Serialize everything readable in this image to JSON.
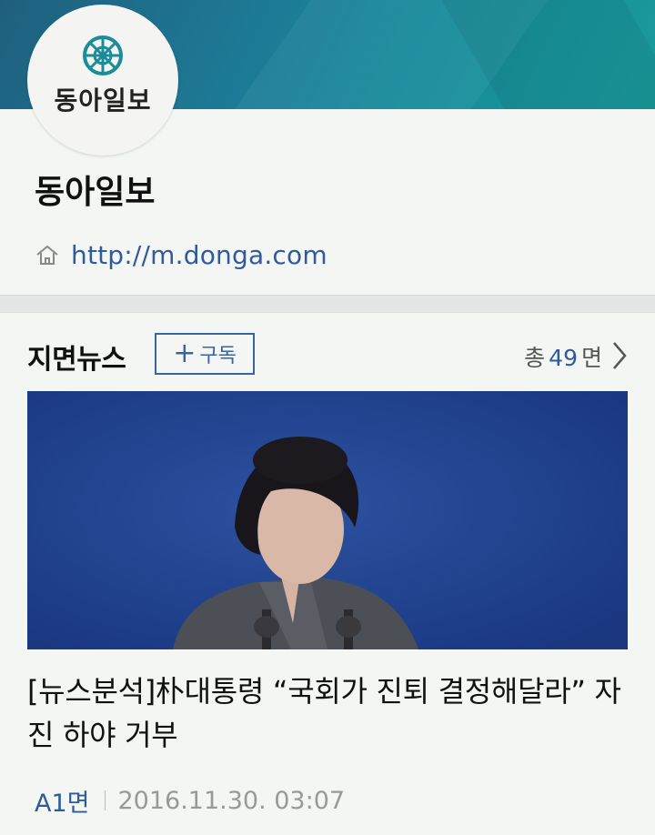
{
  "header": {
    "logo_text": "동아일보",
    "publisher_name": "동아일보",
    "url": "http://m.donga.com"
  },
  "section": {
    "title": "지면뉴스",
    "subscribe_label": "구독",
    "subscribe_icon": "plus-icon",
    "total_prefix": "총",
    "total_count": "49",
    "total_suffix": "면"
  },
  "article": {
    "headline": "[뉴스분석]朴대통령 “국회가 진퇴 결정해달라” 자진 하야 거부",
    "page": "A1면",
    "date": "2016.11.30. 03:07"
  },
  "colors": {
    "accent": "#2f5b9a",
    "banner": "#1d7a96",
    "emblem": "#1a8c9a"
  }
}
